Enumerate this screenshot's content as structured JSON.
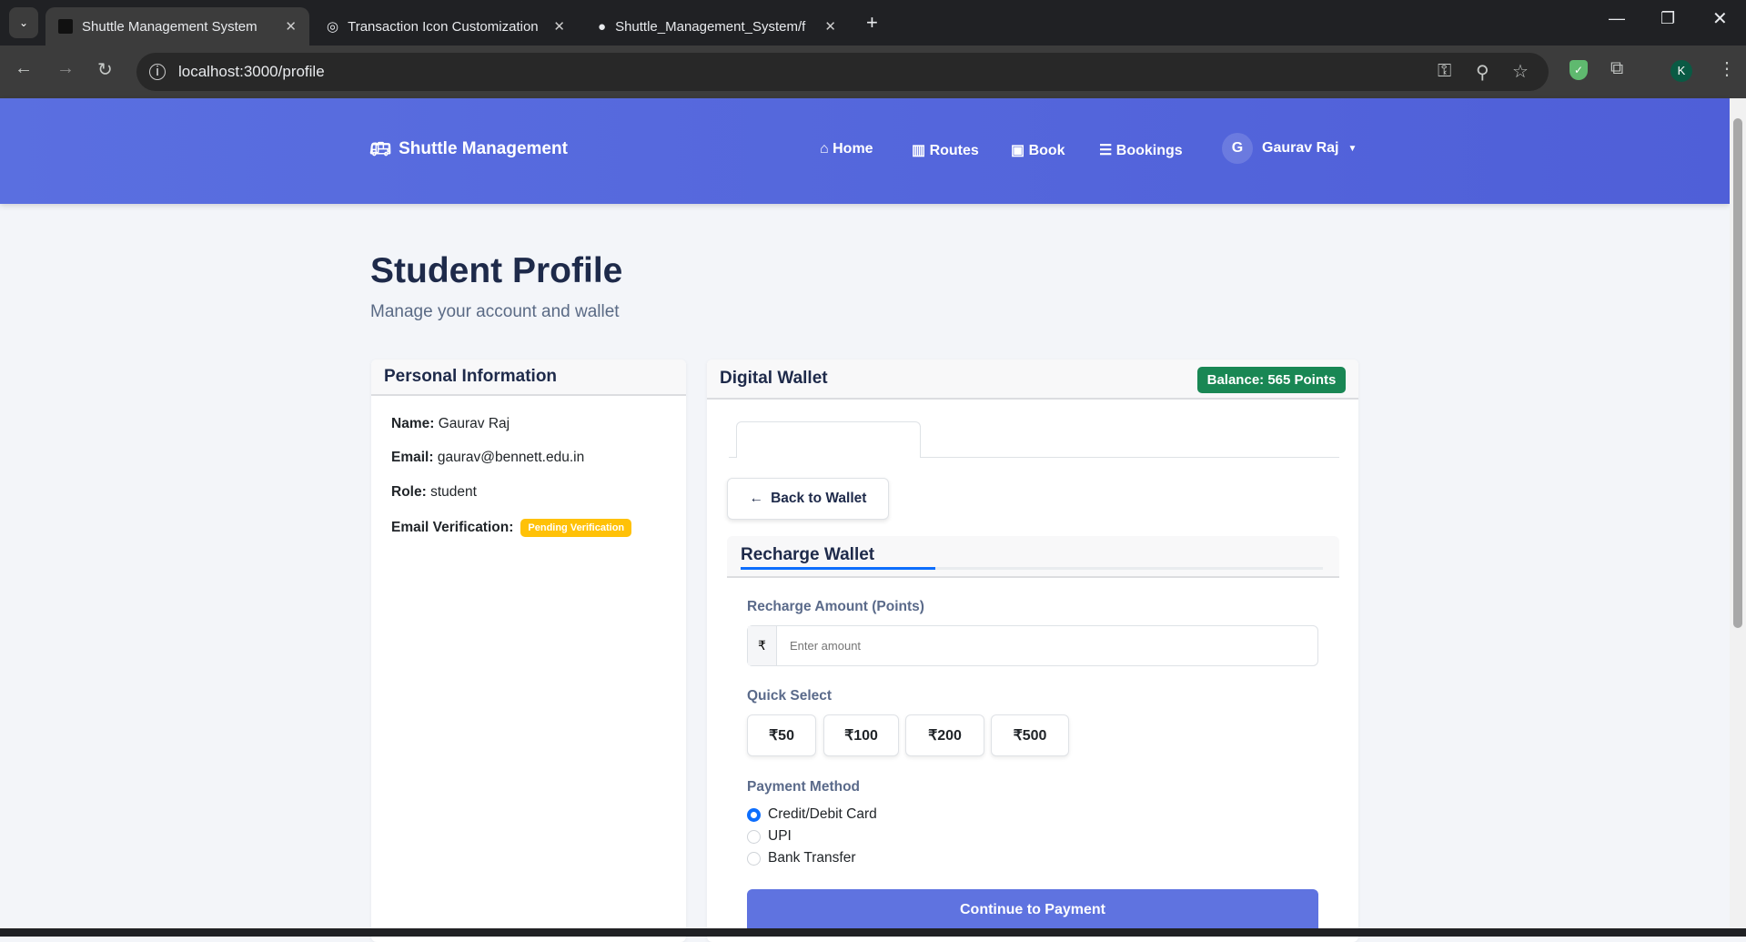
{
  "browser": {
    "tabs": [
      {
        "title": "Shuttle Management System",
        "active": true
      },
      {
        "title": "Transaction Icon Customization",
        "active": false
      },
      {
        "title": "Shuttle_Management_System/fr",
        "active": false
      }
    ],
    "url": "localhost:3000/profile",
    "profile_initial": "K"
  },
  "navbar": {
    "brand": "Shuttle Management",
    "items": [
      {
        "label": "Home",
        "icon": "home-icon"
      },
      {
        "label": "Routes",
        "icon": "map-icon"
      },
      {
        "label": "Book",
        "icon": "calendar-plus-icon"
      },
      {
        "label": "Bookings",
        "icon": "list-icon"
      }
    ],
    "user": {
      "initial": "G",
      "name": "Gaurav Raj"
    }
  },
  "page": {
    "title": "Student Profile",
    "subtitle": "Manage your account and wallet"
  },
  "personal": {
    "title": "Personal Information",
    "fields": [
      {
        "label": "Name:",
        "value": "Gaurav Raj"
      },
      {
        "label": "Email:",
        "value": "gaurav@bennett.edu.in"
      },
      {
        "label": "Role:",
        "value": "student"
      }
    ],
    "verification_label": "Email Verification:",
    "verification_badge": "Pending Verification"
  },
  "wallet": {
    "title": "Digital Wallet",
    "balance": "Balance: 565 Points",
    "back_label": "Back to Wallet",
    "recharge": {
      "title": "Recharge Wallet",
      "amount_label": "Recharge Amount (Points)",
      "currency": "₹",
      "placeholder": "Enter amount",
      "quick_label": "Quick Select",
      "quick": [
        "₹50",
        "₹100",
        "₹200",
        "₹500"
      ],
      "payment_label": "Payment Method",
      "methods": [
        {
          "label": "Credit/Debit Card",
          "selected": true
        },
        {
          "label": "UPI",
          "selected": false
        },
        {
          "label": "Bank Transfer",
          "selected": false
        }
      ],
      "submit": "Continue to Payment"
    }
  },
  "colors": {
    "primary": "#5a6fe0",
    "success": "#198754",
    "warning": "#ffc107",
    "accent": "#0d6efd"
  }
}
